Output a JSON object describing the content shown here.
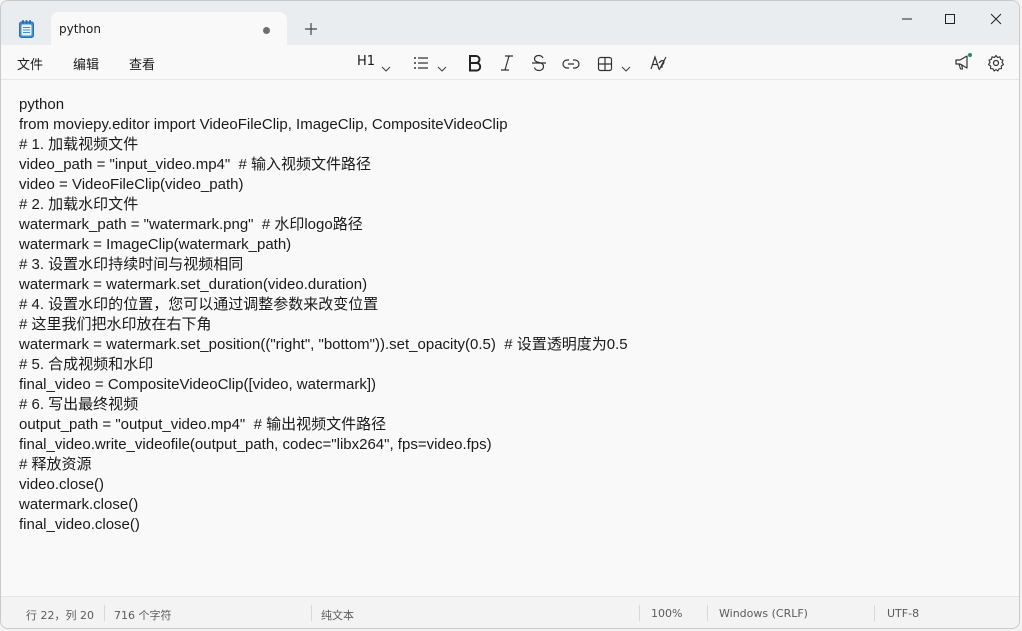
{
  "tab": {
    "title": "python"
  },
  "menu": {
    "file": "文件",
    "edit": "编辑",
    "view": "查看"
  },
  "toolbar": {
    "heading": "H1"
  },
  "editor": {
    "lines": [
      "python",
      "from moviepy.editor import VideoFileClip, ImageClip, CompositeVideoClip",
      "# 1. 加载视频文件",
      "video_path = \"input_video.mp4\"  # 输入视频文件路径",
      "video = VideoFileClip(video_path)",
      "# 2. 加载水印文件",
      "watermark_path = \"watermark.png\"  # 水印logo路径",
      "watermark = ImageClip(watermark_path)",
      "# 3. 设置水印持续时间与视频相同",
      "watermark = watermark.set_duration(video.duration)",
      "# 4. 设置水印的位置，您可以通过调整参数来改变位置",
      "# 这里我们把水印放在右下角",
      "watermark = watermark.set_position((\"right\", \"bottom\")).set_opacity(0.5)  # 设置透明度为0.5",
      "# 5. 合成视频和水印",
      "final_video = CompositeVideoClip([video, watermark])",
      "# 6. 写出最终视频",
      "output_path = \"output_video.mp4\"  # 输出视频文件路径",
      "final_video.write_videofile(output_path, codec=\"libx264\", fps=video.fps)",
      "# 释放资源",
      "video.close()",
      "watermark.close()",
      "final_video.close()"
    ]
  },
  "status": {
    "position": "行 22，列 20",
    "chars": "716 个字符",
    "format": "纯文本",
    "zoom": "100%",
    "line_ending": "Windows (CRLF)",
    "encoding": "UTF-8"
  },
  "colors": {
    "titlebar": "#eaedf0",
    "editor": "#f9f9f9",
    "accent": "#1f8a70"
  }
}
